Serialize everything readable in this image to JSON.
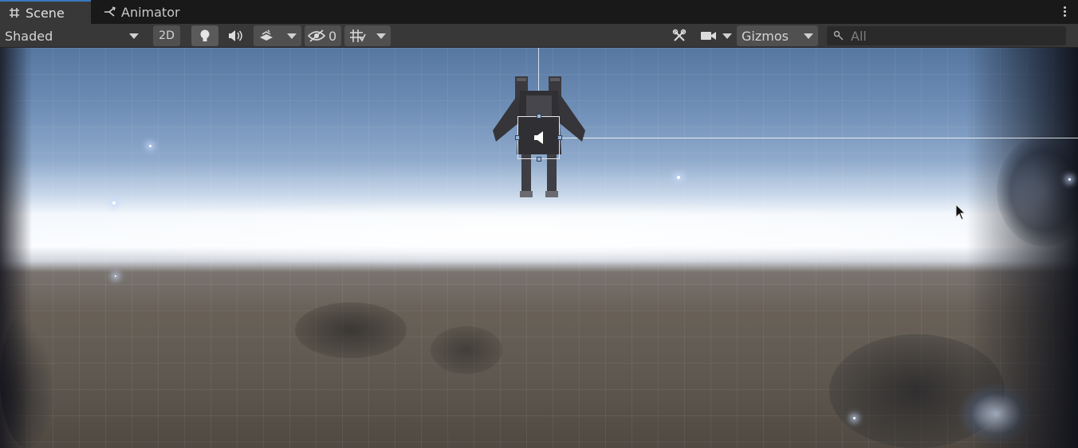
{
  "tabs": [
    {
      "label": "Scene",
      "icon": "grid-hash-icon",
      "active": true
    },
    {
      "label": "Animator",
      "icon": "animator-branch-icon",
      "active": false
    }
  ],
  "toolbar": {
    "draw_mode": "Shaded",
    "toggle_2d": "2D",
    "hidden_count": "0",
    "gizmos_label": "Gizmos",
    "search_placeholder": "All"
  },
  "scene": {
    "selected_object": "audio-source-object",
    "background": "starry sky skybox"
  },
  "colors": {
    "tab_active_accent": "#3a79bb",
    "toolbar_bg": "#383838",
    "tabbar_bg": "#191919",
    "button_bg": "#505050"
  }
}
